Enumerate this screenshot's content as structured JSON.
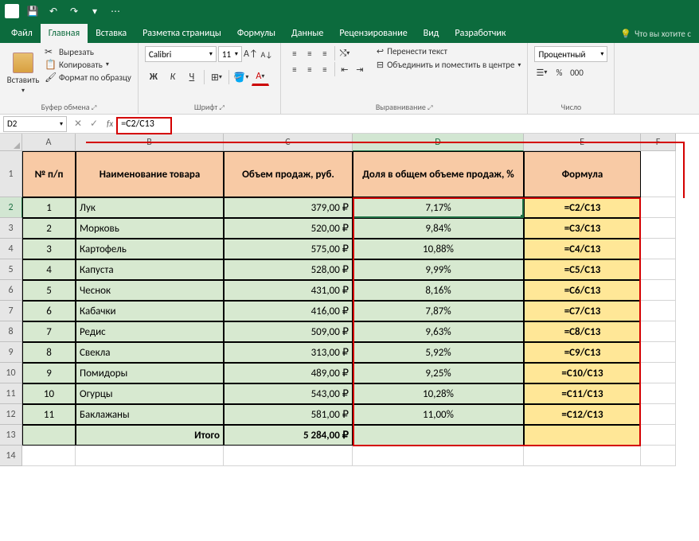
{
  "qat": {
    "save": "💾",
    "undo": "↶",
    "redo": "↷"
  },
  "tabs": {
    "file": "Файл",
    "home": "Главная",
    "insert": "Вставка",
    "layout": "Разметка страницы",
    "formulas": "Формулы",
    "data": "Данные",
    "review": "Рецензирование",
    "view": "Вид",
    "dev": "Разработчик",
    "hint": "Что вы хотите с"
  },
  "ribbon": {
    "clipboard": {
      "paste": "Вставить",
      "cut": "Вырезать",
      "copy": "Копировать",
      "format": "Формат по образцу",
      "label": "Буфер обмена"
    },
    "font": {
      "name": "Calibri",
      "size": "11",
      "label": "Шрифт",
      "bold": "Ж",
      "italic": "К",
      "underline": "Ч",
      "Aplus": "A",
      "Aminus": "A"
    },
    "align": {
      "wrap": "Перенести текст",
      "merge": "Объединить и поместить в центре",
      "label": "Выравнивание"
    },
    "number": {
      "format": "Процентный",
      "label": "Число",
      "cur": "%"
    }
  },
  "formulabar": {
    "cell": "D2",
    "formula": "=C2/C13"
  },
  "columns": [
    "A",
    "B",
    "C",
    "D",
    "E",
    "F"
  ],
  "headers": {
    "A": "№ п/п",
    "B": "Наименование товара",
    "C": "Объем продаж, руб.",
    "D": "Доля в общем объеме продаж, %",
    "E": "Формула"
  },
  "rows": [
    {
      "n": "1",
      "name": "Лук",
      "vol": "379,00 ₽",
      "share": "7,17%",
      "f": "=C2/C13"
    },
    {
      "n": "2",
      "name": "Морковь",
      "vol": "520,00 ₽",
      "share": "9,84%",
      "f": "=C3/C13"
    },
    {
      "n": "3",
      "name": "Картофель",
      "vol": "575,00 ₽",
      "share": "10,88%",
      "f": "=C4/C13"
    },
    {
      "n": "4",
      "name": "Капуста",
      "vol": "528,00 ₽",
      "share": "9,99%",
      "f": "=C5/C13"
    },
    {
      "n": "5",
      "name": "Чеснок",
      "vol": "431,00 ₽",
      "share": "8,16%",
      "f": "=C6/C13"
    },
    {
      "n": "6",
      "name": "Кабачки",
      "vol": "416,00 ₽",
      "share": "7,87%",
      "f": "=C7/C13"
    },
    {
      "n": "7",
      "name": "Редис",
      "vol": "509,00 ₽",
      "share": "9,63%",
      "f": "=C8/C13"
    },
    {
      "n": "8",
      "name": "Свекла",
      "vol": "313,00 ₽",
      "share": "5,92%",
      "f": "=C9/C13"
    },
    {
      "n": "9",
      "name": "Помидоры",
      "vol": "489,00 ₽",
      "share": "9,25%",
      "f": "=C10/C13"
    },
    {
      "n": "10",
      "name": "Огурцы",
      "vol": "543,00 ₽",
      "share": "10,28%",
      "f": "=C11/C13"
    },
    {
      "n": "11",
      "name": "Баклажаны",
      "vol": "581,00 ₽",
      "share": "11,00%",
      "f": "=C12/C13"
    }
  ],
  "total": {
    "label": "Итого",
    "vol": "5 284,00 ₽"
  }
}
